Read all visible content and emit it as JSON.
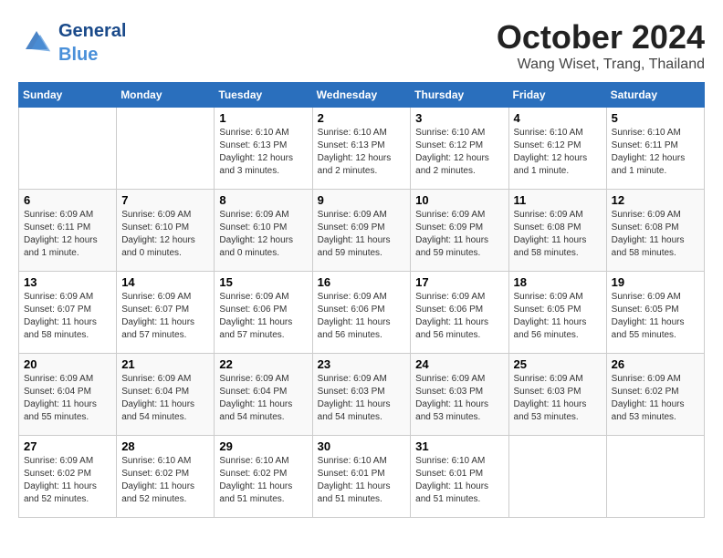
{
  "header": {
    "logo_text_general": "General",
    "logo_text_blue": "Blue",
    "month": "October 2024",
    "location": "Wang Wiset, Trang, Thailand"
  },
  "days_of_week": [
    "Sunday",
    "Monday",
    "Tuesday",
    "Wednesday",
    "Thursday",
    "Friday",
    "Saturday"
  ],
  "weeks": [
    [
      {
        "day": "",
        "info": ""
      },
      {
        "day": "",
        "info": ""
      },
      {
        "day": "1",
        "info": "Sunrise: 6:10 AM\nSunset: 6:13 PM\nDaylight: 12 hours and 3 minutes."
      },
      {
        "day": "2",
        "info": "Sunrise: 6:10 AM\nSunset: 6:13 PM\nDaylight: 12 hours and 2 minutes."
      },
      {
        "day": "3",
        "info": "Sunrise: 6:10 AM\nSunset: 6:12 PM\nDaylight: 12 hours and 2 minutes."
      },
      {
        "day": "4",
        "info": "Sunrise: 6:10 AM\nSunset: 6:12 PM\nDaylight: 12 hours and 1 minute."
      },
      {
        "day": "5",
        "info": "Sunrise: 6:10 AM\nSunset: 6:11 PM\nDaylight: 12 hours and 1 minute."
      }
    ],
    [
      {
        "day": "6",
        "info": "Sunrise: 6:09 AM\nSunset: 6:11 PM\nDaylight: 12 hours and 1 minute."
      },
      {
        "day": "7",
        "info": "Sunrise: 6:09 AM\nSunset: 6:10 PM\nDaylight: 12 hours and 0 minutes."
      },
      {
        "day": "8",
        "info": "Sunrise: 6:09 AM\nSunset: 6:10 PM\nDaylight: 12 hours and 0 minutes."
      },
      {
        "day": "9",
        "info": "Sunrise: 6:09 AM\nSunset: 6:09 PM\nDaylight: 11 hours and 59 minutes."
      },
      {
        "day": "10",
        "info": "Sunrise: 6:09 AM\nSunset: 6:09 PM\nDaylight: 11 hours and 59 minutes."
      },
      {
        "day": "11",
        "info": "Sunrise: 6:09 AM\nSunset: 6:08 PM\nDaylight: 11 hours and 58 minutes."
      },
      {
        "day": "12",
        "info": "Sunrise: 6:09 AM\nSunset: 6:08 PM\nDaylight: 11 hours and 58 minutes."
      }
    ],
    [
      {
        "day": "13",
        "info": "Sunrise: 6:09 AM\nSunset: 6:07 PM\nDaylight: 11 hours and 58 minutes."
      },
      {
        "day": "14",
        "info": "Sunrise: 6:09 AM\nSunset: 6:07 PM\nDaylight: 11 hours and 57 minutes."
      },
      {
        "day": "15",
        "info": "Sunrise: 6:09 AM\nSunset: 6:06 PM\nDaylight: 11 hours and 57 minutes."
      },
      {
        "day": "16",
        "info": "Sunrise: 6:09 AM\nSunset: 6:06 PM\nDaylight: 11 hours and 56 minutes."
      },
      {
        "day": "17",
        "info": "Sunrise: 6:09 AM\nSunset: 6:06 PM\nDaylight: 11 hours and 56 minutes."
      },
      {
        "day": "18",
        "info": "Sunrise: 6:09 AM\nSunset: 6:05 PM\nDaylight: 11 hours and 56 minutes."
      },
      {
        "day": "19",
        "info": "Sunrise: 6:09 AM\nSunset: 6:05 PM\nDaylight: 11 hours and 55 minutes."
      }
    ],
    [
      {
        "day": "20",
        "info": "Sunrise: 6:09 AM\nSunset: 6:04 PM\nDaylight: 11 hours and 55 minutes."
      },
      {
        "day": "21",
        "info": "Sunrise: 6:09 AM\nSunset: 6:04 PM\nDaylight: 11 hours and 54 minutes."
      },
      {
        "day": "22",
        "info": "Sunrise: 6:09 AM\nSunset: 6:04 PM\nDaylight: 11 hours and 54 minutes."
      },
      {
        "day": "23",
        "info": "Sunrise: 6:09 AM\nSunset: 6:03 PM\nDaylight: 11 hours and 54 minutes."
      },
      {
        "day": "24",
        "info": "Sunrise: 6:09 AM\nSunset: 6:03 PM\nDaylight: 11 hours and 53 minutes."
      },
      {
        "day": "25",
        "info": "Sunrise: 6:09 AM\nSunset: 6:03 PM\nDaylight: 11 hours and 53 minutes."
      },
      {
        "day": "26",
        "info": "Sunrise: 6:09 AM\nSunset: 6:02 PM\nDaylight: 11 hours and 53 minutes."
      }
    ],
    [
      {
        "day": "27",
        "info": "Sunrise: 6:09 AM\nSunset: 6:02 PM\nDaylight: 11 hours and 52 minutes."
      },
      {
        "day": "28",
        "info": "Sunrise: 6:10 AM\nSunset: 6:02 PM\nDaylight: 11 hours and 52 minutes."
      },
      {
        "day": "29",
        "info": "Sunrise: 6:10 AM\nSunset: 6:02 PM\nDaylight: 11 hours and 51 minutes."
      },
      {
        "day": "30",
        "info": "Sunrise: 6:10 AM\nSunset: 6:01 PM\nDaylight: 11 hours and 51 minutes."
      },
      {
        "day": "31",
        "info": "Sunrise: 6:10 AM\nSunset: 6:01 PM\nDaylight: 11 hours and 51 minutes."
      },
      {
        "day": "",
        "info": ""
      },
      {
        "day": "",
        "info": ""
      }
    ]
  ]
}
